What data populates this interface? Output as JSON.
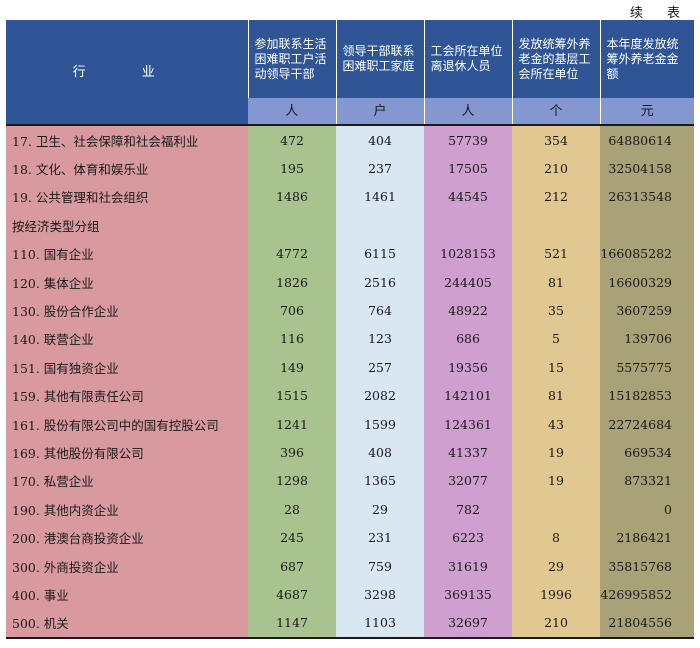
{
  "continued_label": "续 表",
  "header": {
    "industry": "行 业",
    "columns": [
      "参加联系生活困难职工户活动领导干部",
      "领导干部联系困难职工家庭",
      "工会所在单位离退休人员",
      "发放统筹外养老金的基层工会所在单位",
      "本年度发放统筹外养老金金额"
    ],
    "units": [
      "人",
      "户",
      "人",
      "个",
      "元"
    ]
  },
  "rows": [
    {
      "industry": "17. 卫生、社会保障和社会福利业",
      "values": [
        "472",
        "404",
        "57739",
        "354",
        "64880614"
      ]
    },
    {
      "industry": "18. 文化、体育和娱乐业",
      "values": [
        "195",
        "237",
        "17505",
        "210",
        "32504158"
      ]
    },
    {
      "industry": "19. 公共管理和社会组织",
      "values": [
        "1486",
        "1461",
        "44545",
        "212",
        "26313548"
      ]
    },
    {
      "industry": "按经济类型分组",
      "values": [
        "",
        "",
        "",
        "",
        ""
      ]
    },
    {
      "industry": "110. 国有企业",
      "values": [
        "4772",
        "6115",
        "1028153",
        "521",
        "166085282"
      ]
    },
    {
      "industry": "120. 集体企业",
      "values": [
        "1826",
        "2516",
        "244405",
        "81",
        "16600329"
      ]
    },
    {
      "industry": "130. 股份合作企业",
      "values": [
        "706",
        "764",
        "48922",
        "35",
        "3607259"
      ]
    },
    {
      "industry": "140. 联营企业",
      "values": [
        "116",
        "123",
        "686",
        "5",
        "139706"
      ]
    },
    {
      "industry": "151. 国有独资企业",
      "values": [
        "149",
        "257",
        "19356",
        "15",
        "5575775"
      ]
    },
    {
      "industry": "159. 其他有限责任公司",
      "values": [
        "1515",
        "2082",
        "142101",
        "81",
        "15182853"
      ]
    },
    {
      "industry": "161. 股份有限公司中的国有控股公司",
      "values": [
        "1241",
        "1599",
        "124361",
        "43",
        "22724684"
      ]
    },
    {
      "industry": "169. 其他股份有限公司",
      "values": [
        "396",
        "408",
        "41337",
        "19",
        "669534"
      ]
    },
    {
      "industry": "170. 私营企业",
      "values": [
        "1298",
        "1365",
        "32077",
        "19",
        "873321"
      ]
    },
    {
      "industry": "190. 其他内资企业",
      "values": [
        "28",
        "29",
        "782",
        "",
        "0"
      ]
    },
    {
      "industry": "200. 港澳台商投资企业",
      "values": [
        "245",
        "231",
        "6223",
        "8",
        "2186421"
      ]
    },
    {
      "industry": "300. 外商投资企业",
      "values": [
        "687",
        "759",
        "31619",
        "29",
        "35815768"
      ]
    },
    {
      "industry": "400. 事业",
      "values": [
        "4687",
        "3298",
        "369135",
        "1996",
        "426995852"
      ]
    },
    {
      "industry": "500. 机关",
      "values": [
        "1147",
        "1103",
        "32697",
        "210",
        "21804556"
      ]
    }
  ]
}
